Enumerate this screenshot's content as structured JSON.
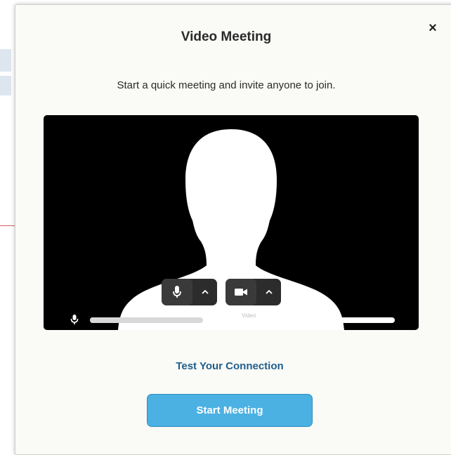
{
  "dialog": {
    "title": "Video Meeting",
    "close_glyph": "×",
    "subtitle": "Start a quick meeting and invite anyone to join."
  },
  "preview": {
    "avatar_icon": "person-silhouette-icon",
    "mic_button_icon": "microphone-icon",
    "mic_options_icon": "chevron-up-icon",
    "camera_button_icon": "video-camera-icon",
    "camera_options_icon": "chevron-up-icon",
    "camera_label": "Video",
    "audio_level_icon": "microphone-icon",
    "audio_level_fraction": 0.37
  },
  "actions": {
    "test_connection_label": "Test Your Connection",
    "start_meeting_label": "Start Meeting"
  },
  "colors": {
    "accent": "#4ab1e2",
    "link": "#1e5e8c",
    "dialog_bg": "#fafaf6",
    "video_bg": "#000000"
  }
}
